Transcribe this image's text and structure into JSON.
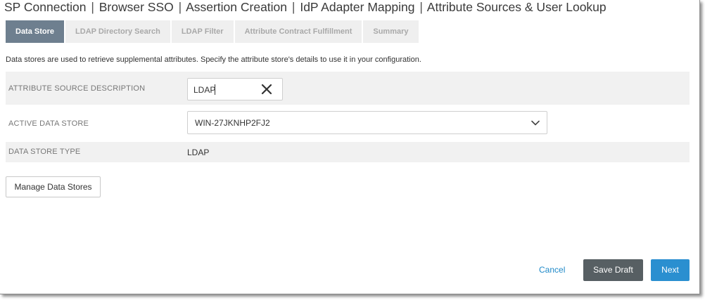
{
  "breadcrumb": {
    "items": [
      "SP Connection",
      "Browser SSO",
      "Assertion Creation",
      "IdP Adapter Mapping",
      "Attribute Sources & User Lookup"
    ],
    "separator": "|"
  },
  "tabs": [
    {
      "label": "Data Store",
      "active": true
    },
    {
      "label": "LDAP Directory Search",
      "active": false
    },
    {
      "label": "LDAP Filter",
      "active": false
    },
    {
      "label": "Attribute Contract Fulfillment",
      "active": false
    },
    {
      "label": "Summary",
      "active": false
    }
  ],
  "intro_text": "Data stores are used to retrieve supplemental attributes. Specify the attribute store's details to use it in your configuration.",
  "fields": {
    "description": {
      "label": "ATTRIBUTE SOURCE DESCRIPTION",
      "value": "LDAP",
      "clear_icon": "close-icon"
    },
    "active_store": {
      "label": "ACTIVE DATA STORE",
      "value": "WIN-27JKNHP2FJ2",
      "icon": "chevron-down-icon"
    },
    "store_type": {
      "label": "DATA STORE TYPE",
      "value": "LDAP"
    }
  },
  "buttons": {
    "manage": "Manage Data Stores",
    "cancel": "Cancel",
    "save_draft": "Save Draft",
    "next": "Next"
  },
  "colors": {
    "active_tab": "#6e7f8f",
    "primary": "#2a8fd0",
    "secondary": "#575f63",
    "link": "#1e89c8"
  }
}
